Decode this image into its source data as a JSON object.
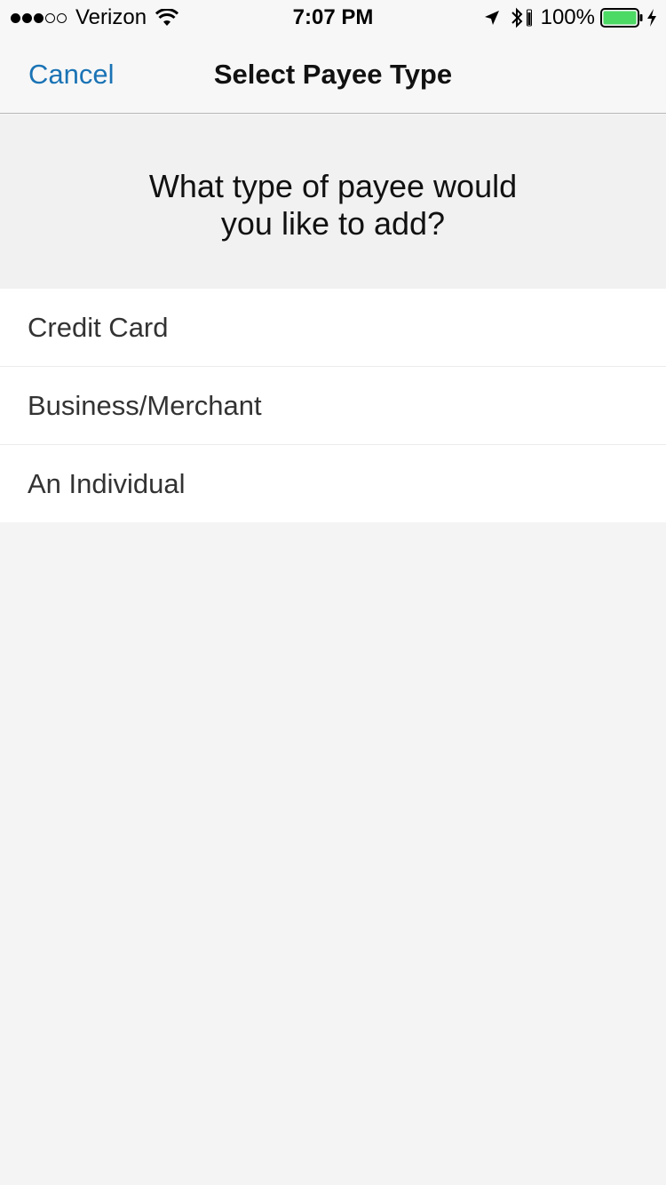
{
  "status_bar": {
    "carrier": "Verizon",
    "signal_bars_filled": 3,
    "signal_bars_total": 5,
    "time": "7:07 PM",
    "battery_percent": "100%",
    "battery_color": "#4cd964",
    "icons": [
      "wifi-icon",
      "location-icon",
      "bluetooth-icon",
      "battery-icon",
      "charging-icon"
    ]
  },
  "nav": {
    "cancel_label": "Cancel",
    "title": "Select Payee Type",
    "accent_color": "#1a73b5"
  },
  "prompt": {
    "line1": "What type of payee would",
    "line2": "you like to add?"
  },
  "options": [
    {
      "label": "Credit Card"
    },
    {
      "label": "Business/Merchant"
    },
    {
      "label": "An Individual"
    }
  ]
}
